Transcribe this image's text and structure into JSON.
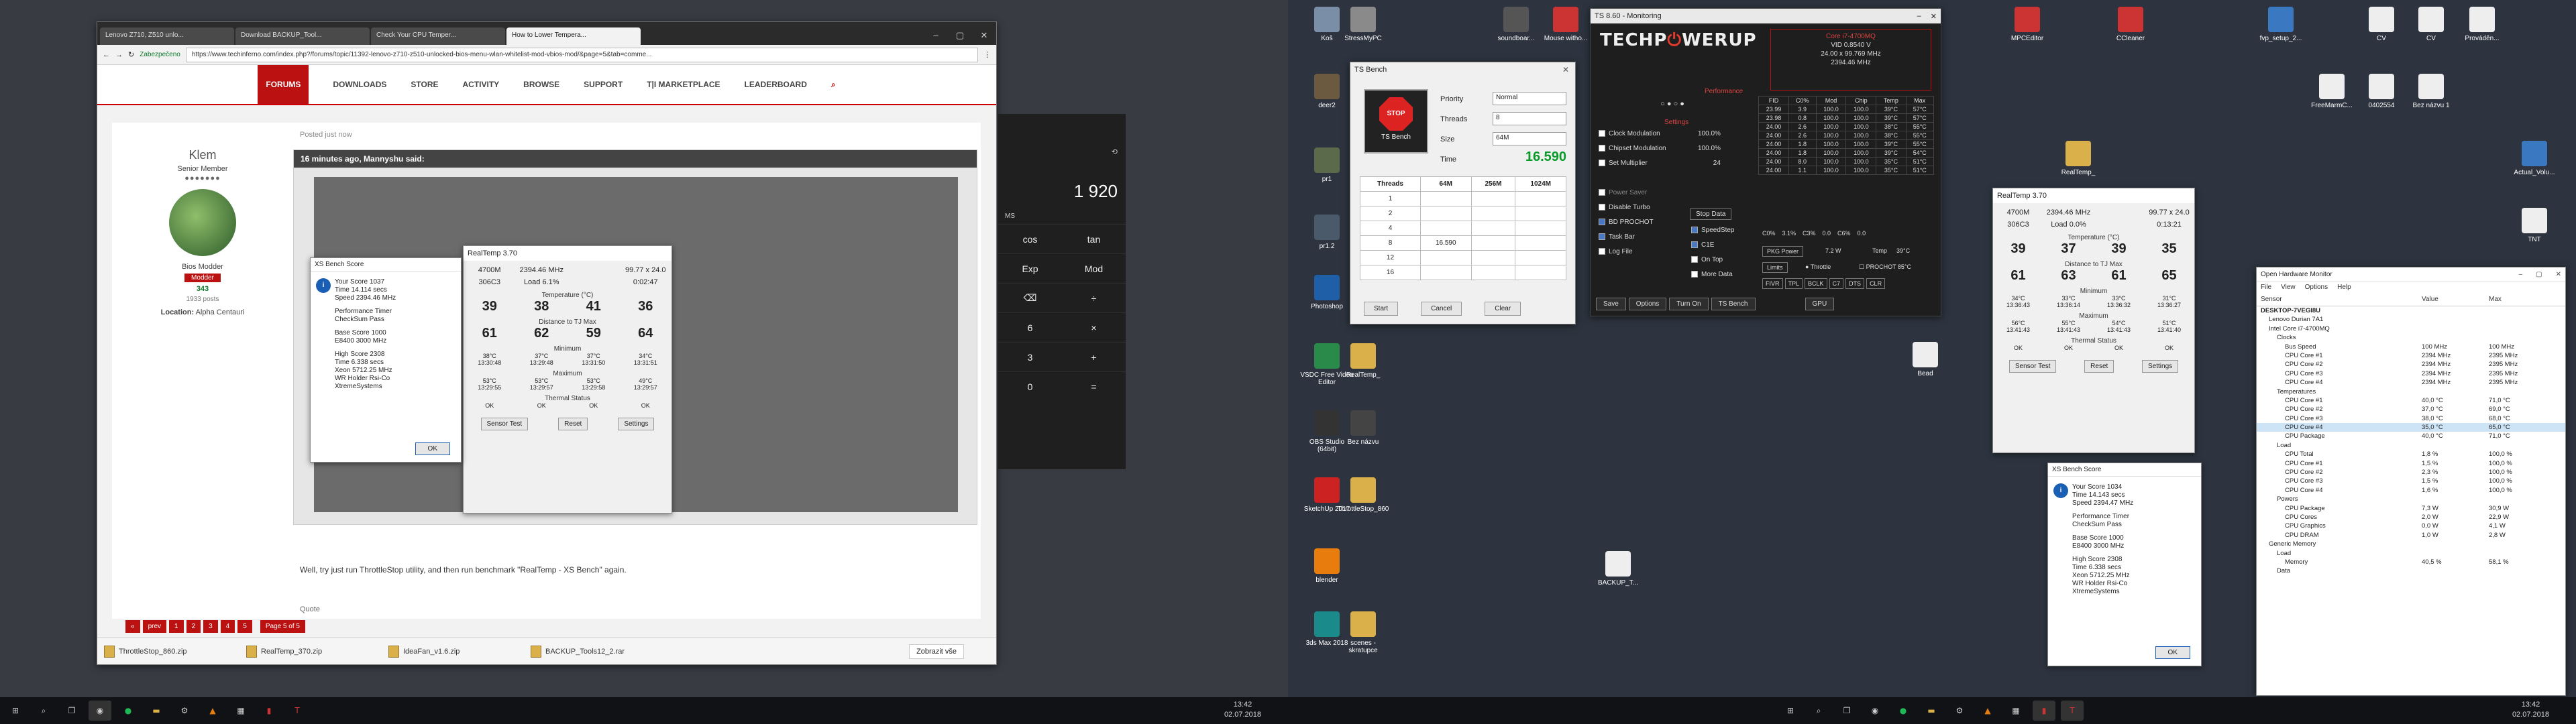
{
  "chrome": {
    "tabs": [
      "Lenovo Z710, Z510 unlo...",
      "Download BACKUP_Tool...",
      "Check Your CPU Temper...",
      "How to Lower Tempera..."
    ],
    "secure_label": "Zabezpečeno",
    "url": "https://www.techinferno.com/index.php?/forums/topic/11392-lenovo-z710-z510-unlocked-bios-menu-wlan-whitelist-mod-vbios-mod/&page=5&tab=comme...",
    "nav": [
      "FORUMS",
      "DOWNLOADS",
      "STORE",
      "ACTIVITY",
      "BROWSE",
      "SUPPORT",
      "T|I MARKETPLACE",
      "LEADERBOARD"
    ],
    "post": {
      "username": "Klem",
      "rank": "Senior Member",
      "role": "Bios Modder",
      "badge": "Modder",
      "reputation": "343",
      "posts": "1933 posts",
      "location_label": "Location:",
      "location": "Alpha Centauri",
      "time": "Posted just now",
      "quote_head": "16 minutes ago, Mannyshu said:",
      "reply": "Well, try just run ThrottleStop utility, and then run benchmark \"RealTemp - XS Bench\" again.",
      "quote_label": "Quote"
    },
    "pager": [
      "«",
      "prev",
      "1",
      "2",
      "3",
      "4",
      "5"
    ],
    "page_of": "Page 5 of 5",
    "downloads": [
      "ThrottleStop_860.zip",
      "RealTemp_370.zip",
      "IdeaFan_v1.6.zip",
      "BACKUP_Tools12_2.rar"
    ],
    "show_all": "Zobrazit vše"
  },
  "calc": {
    "display": "1 920",
    "mem": "MS",
    "rows": [
      [
        "cos",
        "tan"
      ],
      [
        "Exp",
        "Mod"
      ],
      [
        "⌫",
        "÷"
      ],
      [
        "6",
        "×"
      ],
      [
        "3",
        "+"
      ],
      [
        "0",
        "="
      ]
    ]
  },
  "realtemp": [
    {
      "title": "RealTemp 3.70",
      "mhz": "2394.46 MHz",
      "model": "4700M",
      "mult": "99.77 x 24.0",
      "vid": "306C3",
      "load": "Load   6.1%",
      "time": "0:02:47",
      "temp_label": "Temperature (°C)",
      "temps": [
        "39",
        "38",
        "41",
        "36"
      ],
      "dist_label": "Distance to TJ Max",
      "dists": [
        "61",
        "62",
        "59",
        "64"
      ],
      "min_label": "Minimum",
      "mins": [
        "38°C",
        "37°C",
        "37°C",
        "34°C"
      ],
      "min_times": [
        "13:30:48",
        "13:29:48",
        "13:31:50",
        "13:31:51"
      ],
      "max_label": "Maximum",
      "maxs": [
        "53°C",
        "53°C",
        "53°C",
        "49°C"
      ],
      "max_times": [
        "13:29:55",
        "13:29:57",
        "13:29:58",
        "13:29:57"
      ],
      "thermal_label": "Thermal Status",
      "oks": [
        "OK",
        "OK",
        "OK",
        "OK"
      ],
      "buttons": [
        "Sensor Test",
        "Reset",
        "Settings"
      ]
    },
    {
      "title": "RealTemp 3.70",
      "mhz": "2394.46 MHz",
      "model": "4700M",
      "mult": "99.77 x 24.0",
      "vid": "306C3",
      "load": "Load   0.0%",
      "time": "0:13:21",
      "temp_label": "Temperature (°C)",
      "temps": [
        "39",
        "37",
        "39",
        "35"
      ],
      "dist_label": "Distance to TJ Max",
      "dists": [
        "61",
        "63",
        "61",
        "65"
      ],
      "min_label": "Minimum",
      "mins": [
        "34°C",
        "33°C",
        "33°C",
        "31°C"
      ],
      "min_times": [
        "13:36:43",
        "13:36:14",
        "13:36:32",
        "13:36:27"
      ],
      "max_label": "Maximum",
      "maxs": [
        "56°C",
        "55°C",
        "54°C",
        "51°C"
      ],
      "max_times": [
        "13:41:43",
        "13:41:43",
        "13:41:43",
        "13:41:40"
      ],
      "thermal_label": "Thermal Status",
      "oks": [
        "OK",
        "OK",
        "OK",
        "OK"
      ],
      "buttons": [
        "Sensor Test",
        "Reset",
        "Settings"
      ]
    }
  ],
  "xsbench": [
    {
      "title": "XS Bench Score",
      "lines": [
        "Your Score        1037",
        "Time        14.114 secs",
        "Speed     2394.46 MHz",
        "",
        "Performance Timer",
        "CheckSum Pass",
        "",
        "Base Score        1000",
        "E8400        3000 MHz",
        "",
        "High Score        2308",
        "Time        6.338 secs",
        "Xeon     5712.25 MHz",
        "WR Holder   Rsi-Co",
        "XtremeSystems"
      ],
      "ok": "OK"
    },
    {
      "title": "XS Bench Score",
      "lines": [
        "Your Score        1034",
        "Time        14.143 secs",
        "Speed     2394.47 MHz",
        "",
        "Performance Timer",
        "CheckSum Pass",
        "",
        "Base Score        1000",
        "E8400        3000 MHz",
        "",
        "High Score        2308",
        "Time        6.338 secs",
        "Xeon     5712.25 MHz",
        "WR Holder   Rsi-Co",
        "XtremeSystems"
      ],
      "ok": "OK"
    }
  ],
  "throttlestop": {
    "title": "TS 8.60 - Monitoring",
    "logo_a": "TECHP",
    "logo_b": "WERUP",
    "cpu_name": "Core i7-4700MQ",
    "vid": "VID  0.8540 V",
    "mult": "24.00 x 99.769 MHz",
    "mhz": "2394.46 MHz",
    "performance_label": "Performance",
    "settings_label": "Settings",
    "options": [
      {
        "label": "Clock Modulation",
        "val": "100.0%",
        "checked": false
      },
      {
        "label": "Chipset Modulation",
        "val": "100.0%",
        "checked": false
      },
      {
        "label": "Set Multiplier",
        "val": "24",
        "checked": false
      },
      {
        "label": "Power Saver",
        "val": "",
        "checked": false
      },
      {
        "label": "Disable Turbo",
        "val": "",
        "checked": false
      },
      {
        "label": "BD PROCHOT",
        "val": "",
        "checked": true
      },
      {
        "label": "Task Bar",
        "val": "",
        "checked": true
      },
      {
        "label": "Log File",
        "val": "",
        "checked": false
      }
    ],
    "options2": [
      {
        "label": "SpeedStep",
        "checked": true
      },
      {
        "label": "C1E",
        "checked": true
      },
      {
        "label": "On Top",
        "checked": false
      },
      {
        "label": "More Data",
        "checked": false
      }
    ],
    "stop_data": "Stop Data",
    "table_head": [
      "FID",
      "C0%",
      "Mod",
      "Chip",
      "Temp",
      "Max"
    ],
    "table": [
      [
        "23.99",
        "3.9",
        "100.0",
        "100.0",
        "39°C",
        "57°C"
      ],
      [
        "23.98",
        "0.8",
        "100.0",
        "100.0",
        "39°C",
        "57°C"
      ],
      [
        "24.00",
        "2.6",
        "100.0",
        "100.0",
        "38°C",
        "55°C"
      ],
      [
        "24.00",
        "2.6",
        "100.0",
        "100.0",
        "38°C",
        "55°C"
      ],
      [
        "24.00",
        "1.8",
        "100.0",
        "100.0",
        "39°C",
        "55°C"
      ],
      [
        "24.00",
        "1.8",
        "100.0",
        "100.0",
        "39°C",
        "54°C"
      ],
      [
        "24.00",
        "8.0",
        "100.0",
        "100.0",
        "35°C",
        "51°C"
      ],
      [
        "24.00",
        "1.1",
        "100.0",
        "100.0",
        "35°C",
        "51°C"
      ]
    ],
    "cstate": "C0%    3.1%    C3%    0.0    C6%    0.0",
    "pkg_power": "PKG Power",
    "pkg_val": "7.2 W",
    "temp_label": "Temp",
    "temp_val": "39°C",
    "limits": "Limits",
    "throttle": "Throttle",
    "prochot": "PROCHOT 85°C",
    "mini_buttons": [
      "FIVR",
      "TPL",
      "BCLK",
      "C7",
      "DTS",
      "CLR"
    ],
    "bottom_buttons": [
      "Save",
      "Options",
      "Turn On",
      "TS Bench",
      "GPU"
    ]
  },
  "tsbench": {
    "title": "TS Bench",
    "stop_label": "STOP",
    "app_label": "TS Bench",
    "priority_label": "Priority",
    "priority": "Normal",
    "threads_label": "Threads",
    "threads": "8",
    "size_label": "Size",
    "size": "64M",
    "time_label": "Time",
    "time": "16.590",
    "cols": [
      "Threads",
      "64M",
      "256M",
      "1024M"
    ],
    "rows": [
      [
        "1",
        ""
      ],
      [
        "2",
        ""
      ],
      [
        "4",
        ""
      ],
      [
        "8",
        "16.590"
      ],
      [
        "12",
        ""
      ],
      [
        "16",
        ""
      ]
    ],
    "buttons": [
      "Start",
      "Cancel",
      "Clear"
    ]
  },
  "ohm": {
    "title": "Open Hardware Monitor",
    "menu": [
      "File",
      "View",
      "Options",
      "Help"
    ],
    "cols": [
      "Sensor",
      "Value",
      "Max"
    ],
    "rows": [
      [
        "DESKTOP-7VEGI8U",
        "",
        ""
      ],
      [
        "Lenovo Durian 7A1",
        "",
        ""
      ],
      [
        "Intel Core i7-4700MQ",
        "",
        ""
      ],
      [
        "Clocks",
        "",
        ""
      ],
      [
        "Bus Speed",
        "100 MHz",
        "100 MHz"
      ],
      [
        "CPU Core #1",
        "2394 MHz",
        "2395 MHz"
      ],
      [
        "CPU Core #2",
        "2394 MHz",
        "2395 MHz"
      ],
      [
        "CPU Core #3",
        "2394 MHz",
        "2395 MHz"
      ],
      [
        "CPU Core #4",
        "2394 MHz",
        "2395 MHz"
      ],
      [
        "Temperatures",
        "",
        ""
      ],
      [
        "CPU Core #1",
        "40,0 °C",
        "71,0 °C"
      ],
      [
        "CPU Core #2",
        "37,0 °C",
        "69,0 °C"
      ],
      [
        "CPU Core #3",
        "38,0 °C",
        "68,0 °C"
      ],
      [
        "CPU Core #4",
        "35,0 °C",
        "65,0 °C"
      ],
      [
        "CPU Package",
        "40,0 °C",
        "71,0 °C"
      ],
      [
        "Load",
        "",
        ""
      ],
      [
        "CPU Total",
        "1,8 %",
        "100,0 %"
      ],
      [
        "CPU Core #1",
        "1,5 %",
        "100,0 %"
      ],
      [
        "CPU Core #2",
        "2,3 %",
        "100,0 %"
      ],
      [
        "CPU Core #3",
        "1,5 %",
        "100,0 %"
      ],
      [
        "CPU Core #4",
        "1,6 %",
        "100,0 %"
      ],
      [
        "Powers",
        "",
        ""
      ],
      [
        "CPU Package",
        "7,3 W",
        "30,9 W"
      ],
      [
        "CPU Cores",
        "2,0 W",
        "22,9 W"
      ],
      [
        "CPU Graphics",
        "0,0 W",
        "4,1 W"
      ],
      [
        "CPU DRAM",
        "1,0 W",
        "2,8 W"
      ],
      [
        "Generic Memory",
        "",
        ""
      ],
      [
        "Load",
        "",
        ""
      ],
      [
        "Memory",
        "40,5 %",
        "58,1 %"
      ],
      [
        "Data",
        "",
        ""
      ]
    ]
  },
  "desktop_icons": [
    {
      "label": "Koš",
      "color": "#7a8ea8"
    },
    {
      "label": "StressMyPC",
      "color": "#8a8a8a"
    },
    {
      "label": "soundboar...",
      "color": "#555"
    },
    {
      "label": "Mouse witho...",
      "color": "#c33"
    },
    {
      "label": "deer2",
      "color": "#6b5a40"
    },
    {
      "label": "pr1",
      "color": "#5a6a4a"
    },
    {
      "label": "pr1.2",
      "color": "#4a5a6a"
    },
    {
      "label": "Photoshop",
      "color": "#1e5fa8"
    },
    {
      "label": "VSDC Free Video Editor",
      "color": "#2a8a4a"
    },
    {
      "label": "RealTemp_",
      "color": "#d9b04a"
    },
    {
      "label": "OBS Studio (64bit)",
      "color": "#333"
    },
    {
      "label": "Bez názvu",
      "color": "#444"
    },
    {
      "label": "SketchUp 2017",
      "color": "#c22"
    },
    {
      "label": "ThrottleStop_860",
      "color": "#d9b04a"
    },
    {
      "label": "blender",
      "color": "#e87d0d"
    },
    {
      "label": "BACKUP_T...",
      "color": "#eee"
    },
    {
      "label": "3ds Max 2018",
      "color": "#1a8a8a"
    },
    {
      "label": "scenes - skratupce",
      "color": "#d9b04a"
    },
    {
      "label": "MPCEditor",
      "color": "#c33"
    },
    {
      "label": "CCleaner",
      "color": "#c33"
    },
    {
      "label": "fvp_setup_2...",
      "color": "#3a78c2"
    },
    {
      "label": "CV",
      "color": "#eee"
    },
    {
      "label": "CV",
      "color": "#eee"
    },
    {
      "label": "Prováděn...",
      "color": "#eee"
    },
    {
      "label": "FreeMarmC...",
      "color": "#eee"
    },
    {
      "label": "0402554",
      "color": "#eee"
    },
    {
      "label": "Bez názvu 1",
      "color": "#eee"
    },
    {
      "label": "RealTemp_",
      "color": "#d9b04a"
    },
    {
      "label": "Actual_Volu...",
      "color": "#3a78c2"
    },
    {
      "label": "TNT",
      "color": "#eee"
    },
    {
      "label": "Bead",
      "color": "#eee"
    }
  ],
  "taskbar_left": {
    "time": "13:42",
    "date": "02.07.2018"
  },
  "taskbar_right": {
    "time": "13:42",
    "date": "02.07.2018"
  }
}
